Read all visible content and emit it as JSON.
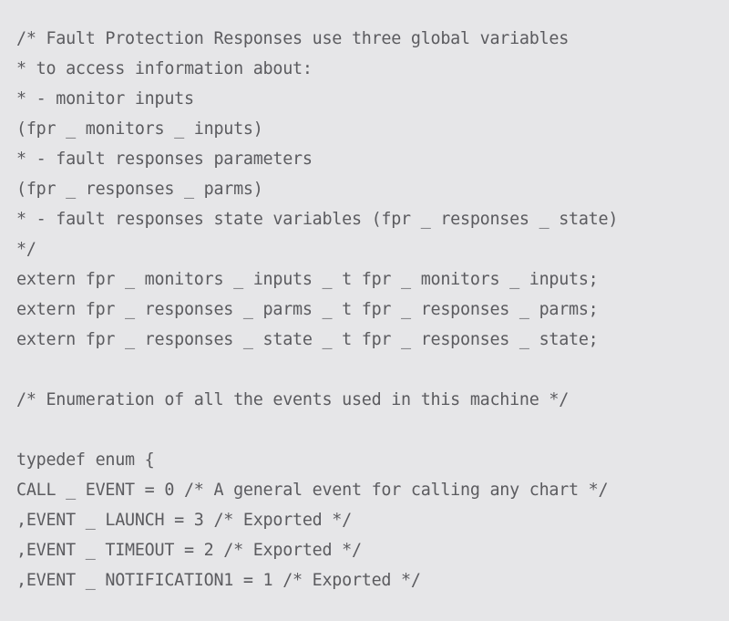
{
  "document": {
    "kind": "source-code-listing",
    "language": "C",
    "background_color": "#e6e6e8",
    "text_color": "#5b5b5f",
    "lines": [
      {
        "id": "l1",
        "text": "/* Fault Protection Responses use three global variables",
        "blank": false
      },
      {
        "id": "l2",
        "text": "* to access information about:",
        "blank": false
      },
      {
        "id": "l3",
        "text": "* - monitor inputs",
        "blank": false
      },
      {
        "id": "l4",
        "text": "(fpr _ monitors _ inputs)",
        "blank": false
      },
      {
        "id": "l5",
        "text": "* - fault responses parameters",
        "blank": false
      },
      {
        "id": "l6",
        "text": "(fpr _ responses _ parms)",
        "blank": false
      },
      {
        "id": "l7",
        "text": "* - fault responses state variables (fpr _ responses _ state)",
        "blank": false
      },
      {
        "id": "l8",
        "text": "*/",
        "blank": false
      },
      {
        "id": "l9",
        "text": "extern fpr _ monitors _ inputs _ t fpr _ monitors _ inputs;",
        "blank": false
      },
      {
        "id": "l10",
        "text": "extern fpr _ responses _ parms _ t fpr _ responses _ parms;",
        "blank": false
      },
      {
        "id": "l11",
        "text": "extern fpr _ responses _ state _ t fpr _ responses _ state;",
        "blank": false
      },
      {
        "id": "l12",
        "text": "",
        "blank": true
      },
      {
        "id": "l13",
        "text": "/* Enumeration of all the events used in this machine */",
        "blank": false
      },
      {
        "id": "l14",
        "text": "",
        "blank": true
      },
      {
        "id": "l15",
        "text": "typedef enum {",
        "blank": false
      },
      {
        "id": "l16",
        "text": "CALL _ EVENT = 0 /* A general event for calling any chart */",
        "blank": false
      },
      {
        "id": "l17",
        "text": ",EVENT _ LAUNCH = 3 /* Exported */",
        "blank": false
      },
      {
        "id": "l18",
        "text": ",EVENT _ TIMEOUT = 2 /* Exported */",
        "blank": false
      },
      {
        "id": "l19",
        "text": ",EVENT _ NOTIFICATION1 = 1 /* Exported */",
        "blank": false
      }
    ]
  }
}
